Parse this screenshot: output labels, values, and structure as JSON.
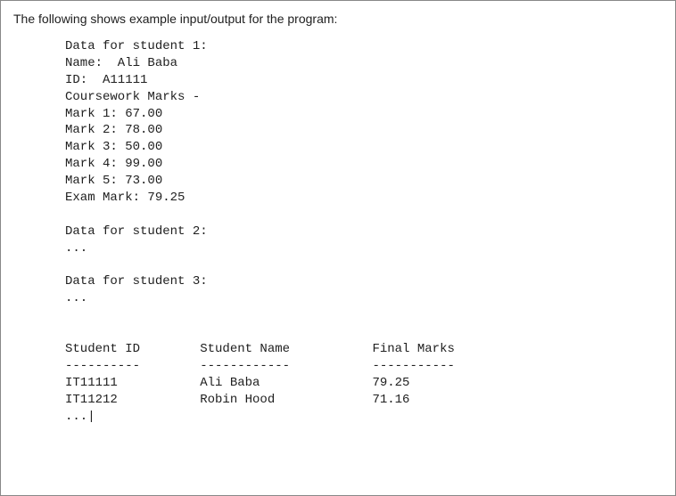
{
  "intro": "The following shows example input/output for the program:",
  "terminal_output": "Data for student 1:\nName:  Ali Baba\nID:  A11111\nCoursework Marks -\nMark 1: 67.00\nMark 2: 78.00\nMark 3: 50.00\nMark 4: 99.00\nMark 5: 73.00\nExam Mark: 79.25\n\nData for student 2:\n...\n\nData for student 3:\n...\n\n\nStudent ID        Student Name           Final Marks\n----------        ------------           -----------\nIT11111           Ali Baba               79.25\nIT11212           Robin Hood             71.16\n...|"
}
